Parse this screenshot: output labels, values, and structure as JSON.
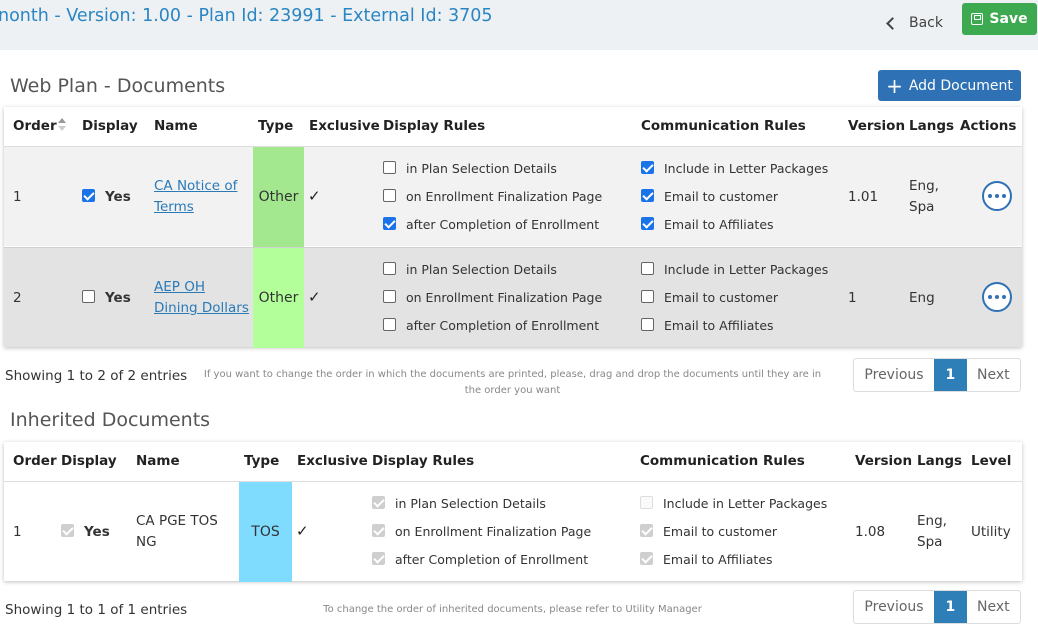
{
  "header": {
    "title": "nonth - Version: 1.00 - Plan Id: 23991 - External Id: 3705",
    "back_label": "Back",
    "save_label": "Save"
  },
  "web_plan": {
    "section_title": "Web Plan - Documents",
    "add_label": "Add Document",
    "columns": [
      "Order",
      "Display",
      "Name",
      "Type",
      "Exclusive",
      "Display Rules",
      "Communication Rules",
      "Version",
      "Langs",
      "Actions"
    ],
    "rows": [
      {
        "order": "1",
        "display_checked": true,
        "display_label": "Yes",
        "name_line1": "CA Notice of",
        "name_line2": "Terms",
        "type": "Other",
        "type_color": "#a3e88f",
        "exclusive": "✓",
        "display_rules": [
          {
            "label": "in Plan Selection Details",
            "checked": false
          },
          {
            "label": "on Enrollment Finalization Page",
            "checked": false
          },
          {
            "label": "after Completion of Enrollment",
            "checked": true
          }
        ],
        "comm_rules": [
          {
            "label": "Include in Letter Packages",
            "checked": true
          },
          {
            "label": "Email to customer",
            "checked": true
          },
          {
            "label": "Email to Affiliates",
            "checked": true
          }
        ],
        "version": "1.01",
        "langs_line1": "Eng,",
        "langs_line2": "Spa",
        "row_bg": "#f2f2f2"
      },
      {
        "order": "2",
        "display_checked": false,
        "display_label": "Yes",
        "name_line1": "AEP OH",
        "name_line2": "Dining Dollars",
        "type": "Other",
        "type_color": "#b3ff99",
        "exclusive": "✓",
        "display_rules": [
          {
            "label": "in Plan Selection Details",
            "checked": false
          },
          {
            "label": "on Enrollment Finalization Page",
            "checked": false
          },
          {
            "label": "after Completion of Enrollment",
            "checked": false
          }
        ],
        "comm_rules": [
          {
            "label": "Include in Letter Packages",
            "checked": false
          },
          {
            "label": "Email to customer",
            "checked": false
          },
          {
            "label": "Email to Affiliates",
            "checked": false
          }
        ],
        "version": "1",
        "langs_line1": "Eng",
        "langs_line2": "",
        "row_bg": "#e3e3e3"
      }
    ],
    "showing": "Showing 1 to 2 of 2 entries",
    "note": "If you want to change the order in which the documents are printed, please, drag and drop the documents until they are in the order you want",
    "pager": {
      "prev": "Previous",
      "page": "1",
      "next": "Next"
    }
  },
  "inherited": {
    "section_title": "Inherited Documents",
    "columns": [
      "Order",
      "Display",
      "Name",
      "Type",
      "Exclusive",
      "Display Rules",
      "Communication Rules",
      "Version",
      "Langs",
      "Level"
    ],
    "row": {
      "order": "1",
      "display_checked": true,
      "display_label": "Yes",
      "name_line1": "CA PGE TOS",
      "name_line2": "NG",
      "type": "TOS",
      "type_color": "#7fdcff",
      "exclusive": "✓",
      "display_rules": [
        {
          "label": "in Plan Selection Details",
          "checked": true
        },
        {
          "label": "on Enrollment Finalization Page",
          "checked": true
        },
        {
          "label": "after Completion of Enrollment",
          "checked": true
        }
      ],
      "comm_rules": [
        {
          "label": "Include in Letter Packages",
          "checked": false
        },
        {
          "label": "Email to customer",
          "checked": true
        },
        {
          "label": "Email to Affiliates",
          "checked": true
        }
      ],
      "version": "1.08",
      "langs_line1": "Eng,",
      "langs_line2": "Spa",
      "level": "Utility"
    },
    "showing": "Showing 1 to 1 of 1 entries",
    "note": "To change the order of inherited documents, please refer to Utility Manager",
    "pager": {
      "prev": "Previous",
      "page": "1",
      "next": "Next"
    }
  },
  "icons": {
    "back": "chevron-left-icon",
    "save": "floppy-disk-icon",
    "add": "plus-icon",
    "actions": "ellipsis-icon",
    "sort": "sort-icon"
  }
}
